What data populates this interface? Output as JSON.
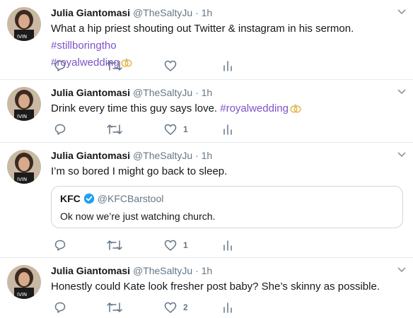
{
  "colors": {
    "accent_hashtag": "#7d52c7",
    "muted": "#657786",
    "border": "#e6ecf0",
    "verified": "#1da1f2"
  },
  "tweets": [
    {
      "name": "Julia Giantomasi",
      "handle": "@TheSaltyJu",
      "sep": "·",
      "time": "1h",
      "text_before": "What a hip priest shouting out Twitter & instagram in his sermon. ",
      "hashtags": [
        "#stillboringtho",
        "#royalwedding"
      ],
      "reply_count": "",
      "retweet_count": "",
      "like_count": ""
    },
    {
      "name": "Julia Giantomasi",
      "handle": "@TheSaltyJu",
      "sep": "·",
      "time": "1h",
      "text_before": "Drink every time this guy says love. ",
      "hashtags": [
        "#royalwedding"
      ],
      "reply_count": "",
      "retweet_count": "",
      "like_count": "1"
    },
    {
      "name": "Julia Giantomasi",
      "handle": "@TheSaltyJu",
      "sep": "·",
      "time": "1h",
      "text_before": "I’m so bored I might go back to sleep.",
      "quote": {
        "name": "KFC",
        "handle": "@KFCBarstool",
        "text": "Ok now we’re just watching church."
      },
      "reply_count": "",
      "retweet_count": "",
      "like_count": "1"
    },
    {
      "name": "Julia Giantomasi",
      "handle": "@TheSaltyJu",
      "sep": "·",
      "time": "1h",
      "text_before": "Honestly could Kate look fresher post baby? She’s skinny as possible.",
      "reply_count": "",
      "retweet_count": "",
      "like_count": "2"
    }
  ]
}
